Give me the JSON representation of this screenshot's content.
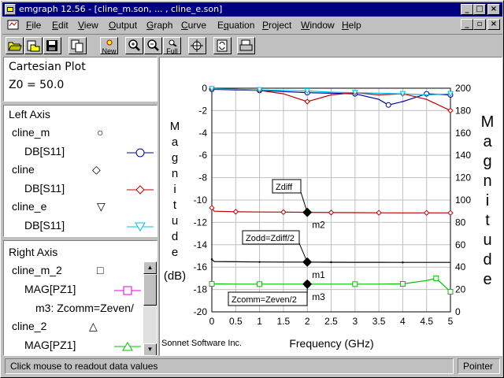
{
  "window": {
    "title": "emgraph 12.56 - [cline_m.son, ... , cline_e.son]"
  },
  "menu": [
    {
      "label": "File",
      "key": "F"
    },
    {
      "label": "Edit",
      "key": "E"
    },
    {
      "label": "View",
      "key": "V"
    },
    {
      "label": "Output",
      "key": "O"
    },
    {
      "label": "Graph",
      "key": "G"
    },
    {
      "label": "Curve",
      "key": "C"
    },
    {
      "label": "Equation",
      "key": "q"
    },
    {
      "label": "Project",
      "key": "P"
    },
    {
      "label": "Window",
      "key": "W"
    },
    {
      "label": "Help",
      "key": "H"
    }
  ],
  "toolbar": {
    "new_label": "New",
    "full_label": "Full"
  },
  "info_panel": {
    "line1": "Cartesian Plot",
    "line2": "Z0 = 50.0"
  },
  "left_axis_panel": {
    "heading": "Left Axis",
    "items": [
      {
        "name": "cline_m",
        "symbol": "○",
        "measure": "DB[S11]",
        "color": "#0000a0",
        "marker": "circle"
      },
      {
        "name": "cline",
        "symbol": "◇",
        "measure": "DB[S11]",
        "color": "#c00000",
        "marker": "diamond"
      },
      {
        "name": "cline_e",
        "symbol": "▽",
        "measure": "DB[S11]",
        "color": "#00c0e0",
        "marker": "triangle-down"
      }
    ]
  },
  "right_axis_panel": {
    "heading": "Right Axis",
    "items": [
      {
        "name": "cline_m_2",
        "symbol": "□",
        "measure": "MAG[PZ1]",
        "color": "#e000e0",
        "marker": "square",
        "extra": "m3: Zcomm=Zeven/"
      },
      {
        "name": "cline_2",
        "symbol": "△",
        "measure": "MAG[PZ1]",
        "color": "#00c000",
        "marker": "triangle-up"
      }
    ]
  },
  "status": {
    "message": "Click mouse to readout data values",
    "mode": "Pointer"
  },
  "plot": {
    "footer": "Sonnet Software Inc."
  },
  "chart_data": {
    "type": "line",
    "xlabel": "Frequency (GHz)",
    "ylabel_left": "Magnitude (dB)",
    "ylabel_right": "Magnitude",
    "xlim": [
      0,
      5
    ],
    "ylim_left": [
      -20,
      0
    ],
    "ylim_right": [
      0,
      200
    ],
    "x_ticks": [
      "0",
      "0.5",
      "1",
      "1.5",
      "2",
      "2.5",
      "3",
      "3.5",
      "4",
      "4.5",
      "5"
    ],
    "y_ticks_left": [
      "0",
      "-2",
      "-4",
      "-6",
      "-8",
      "-10",
      "-12",
      "-14",
      "-16",
      "-18",
      "-20"
    ],
    "y_ticks_right": [
      "200",
      "180",
      "160",
      "140",
      "120",
      "100",
      "80",
      "60",
      "40",
      "20",
      "0"
    ],
    "grid": true,
    "series": [
      {
        "name": "cline_m DB[S11]",
        "axis": "left",
        "color": "#0000a0",
        "marker": "circle",
        "x": [
          0,
          0.5,
          1,
          1.5,
          2,
          2.5,
          3,
          3.5,
          3.7,
          4,
          4.5,
          5
        ],
        "y": [
          -0.1,
          -0.15,
          -0.2,
          -0.3,
          -0.4,
          -0.45,
          -0.5,
          -1.0,
          -1.5,
          -1.2,
          -0.5,
          -0.6
        ]
      },
      {
        "name": "cline DB[S11]",
        "axis": "left",
        "color": "#c00000",
        "marker": "diamond",
        "x": [
          0,
          0.5,
          1,
          1.5,
          2,
          2.5,
          3,
          3.5,
          4,
          4.5,
          5
        ],
        "y": [
          -0.05,
          -0.1,
          -0.2,
          -0.5,
          -1.2,
          -0.6,
          -0.4,
          -0.6,
          -0.5,
          -1.0,
          -2.0
        ]
      },
      {
        "name": "cline_e DB[S11]",
        "axis": "left",
        "color": "#00c0e0",
        "marker": "triangle-down",
        "x": [
          0,
          0.5,
          1,
          1.5,
          2,
          2.5,
          3,
          3.5,
          4,
          4.5,
          5
        ],
        "y": [
          -0.05,
          -0.1,
          -0.15,
          -0.2,
          -0.25,
          -0.35,
          -0.4,
          -0.45,
          -0.5,
          -0.6,
          -0.5
        ]
      },
      {
        "name": "Zdiff",
        "axis": "right",
        "color": "#c00000",
        "marker": "diamond",
        "x": [
          0,
          0.05,
          0.5,
          1,
          1.5,
          2,
          2.5,
          3,
          3.5,
          4,
          4.5,
          5
        ],
        "y": [
          93,
          90,
          89.5,
          89.3,
          89.2,
          89,
          88.8,
          88.7,
          88.6,
          88.5,
          88.5,
          88.5
        ]
      },
      {
        "name": "Zodd",
        "axis": "right",
        "color": "#000000",
        "marker": "none",
        "x": [
          0,
          0.05,
          0.5,
          1,
          1.5,
          2,
          2.5,
          3,
          3.5,
          4,
          4.5,
          5
        ],
        "y": [
          47,
          45,
          44.8,
          44.6,
          44.5,
          44.5,
          44.4,
          44.3,
          44.3,
          44.2,
          44.2,
          44.2
        ]
      },
      {
        "name": "Zcomm",
        "axis": "right",
        "color": "#00c000",
        "marker": "square",
        "x": [
          0,
          0.5,
          1,
          1.5,
          2,
          2.5,
          3,
          3.5,
          4,
          4.5,
          4.7,
          5
        ],
        "y": [
          25,
          24.8,
          24.8,
          24.8,
          24.8,
          24.8,
          24.8,
          24.8,
          25,
          28,
          30,
          18
        ]
      }
    ],
    "markers": [
      {
        "label": "m2",
        "x": 2,
        "y": 89,
        "axis": "right"
      },
      {
        "label": "m1",
        "x": 2,
        "y": 44.5,
        "axis": "right"
      },
      {
        "label": "m3",
        "x": 2,
        "y": 24.8,
        "axis": "right"
      }
    ],
    "annotations": [
      "Zdiff",
      "Zodd=Zdiff/2",
      "Zcomm=Zeven/2"
    ]
  }
}
